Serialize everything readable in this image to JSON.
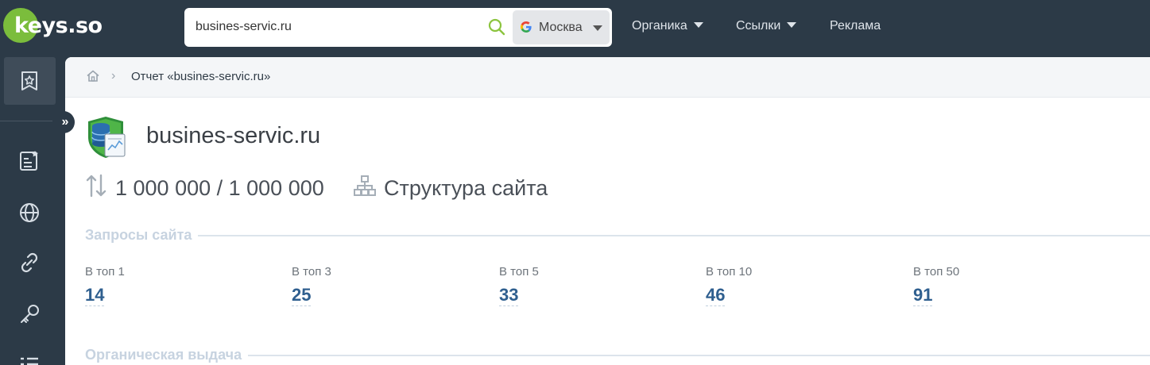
{
  "header": {
    "logo_text": "keys.so",
    "search": {
      "value": "busines-servic.ru",
      "icon": "search-icon"
    },
    "region": {
      "label": "Москва",
      "icon": "google-icon"
    },
    "nav": [
      {
        "label": "Органика",
        "dropdown": true
      },
      {
        "label": "Ссылки",
        "dropdown": true
      },
      {
        "label": "Реклама",
        "dropdown": false
      }
    ]
  },
  "sidebar": {
    "items": [
      {
        "icon": "bookmark-star-icon",
        "active": true
      },
      {
        "icon": "list-star-icon"
      },
      {
        "icon": "globe-icon"
      },
      {
        "icon": "link-icon"
      },
      {
        "icon": "key-icon"
      },
      {
        "icon": "list-icon"
      }
    ],
    "expand_glyph": "»"
  },
  "breadcrumb": {
    "home_icon": "home-icon",
    "separator": "›",
    "current": "Отчет «busines-servic.ru»"
  },
  "report": {
    "site_title": "busines-servic.ru",
    "traffic": "1 000 000 / 1 000 000",
    "structure_link": "Структура сайта"
  },
  "queries_section": {
    "title": "Запросы сайта",
    "stats": [
      {
        "label": "В топ 1",
        "value": "14"
      },
      {
        "label": "В топ 3",
        "value": "25"
      },
      {
        "label": "В топ 5",
        "value": "33"
      },
      {
        "label": "В топ 10",
        "value": "46"
      },
      {
        "label": "В топ 50",
        "value": "91"
      }
    ]
  },
  "organic_section": {
    "title": "Органическая выдача"
  },
  "colors": {
    "topbar": "#2c3a47",
    "logo_green": "#7bbd3c",
    "stat_value": "#2f5f8f",
    "section_title": "#c7d3e0"
  }
}
